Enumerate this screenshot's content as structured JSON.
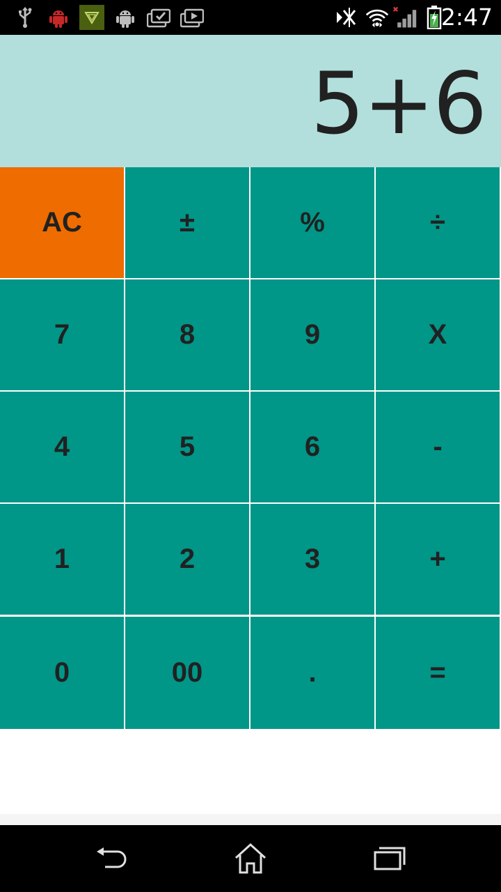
{
  "status_bar": {
    "time": "2:47",
    "left_icons": [
      "usb-icon",
      "android-debug-icon",
      "app-notification-icon",
      "android-icon",
      "briefcase-check-icon",
      "briefcase-play-icon"
    ],
    "right_icons": [
      "nfc-off-icon",
      "wifi-icon",
      "signal-icon",
      "battery-charging-icon"
    ]
  },
  "display": {
    "expression": "5+6"
  },
  "keypad": {
    "colors": {
      "key": "#009688",
      "clear": "#ef6c00",
      "display": "#b2dfdb"
    },
    "rows": [
      [
        "AC",
        "±",
        "%",
        "÷"
      ],
      [
        "7",
        "8",
        "9",
        "X"
      ],
      [
        "4",
        "5",
        "6",
        "-"
      ],
      [
        "1",
        "2",
        "3",
        "+"
      ],
      [
        "0",
        "00",
        ".",
        "="
      ]
    ]
  },
  "navbar": {
    "buttons": [
      "back-icon",
      "home-icon",
      "recent-apps-icon"
    ]
  }
}
